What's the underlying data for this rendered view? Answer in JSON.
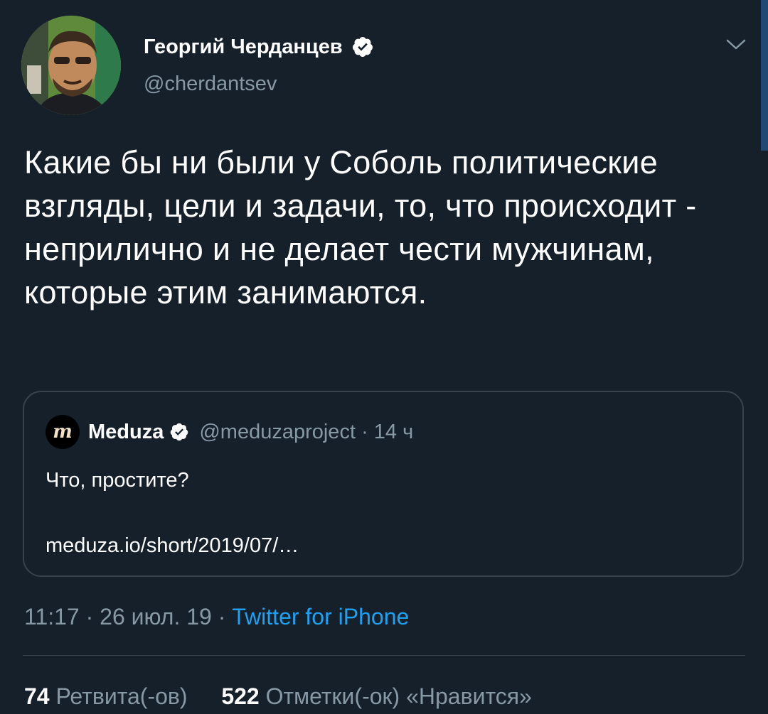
{
  "author": {
    "name": "Георгий Черданцев",
    "handle": "@cherdantsev",
    "verified": true,
    "avatar_icon": "profile-photo"
  },
  "tweet": {
    "text": "Какие бы ни были у Соболь политические взгляды, цели и задачи, то, что происходит - неприлично и не делает чести мужчинам, которые этим занимаются."
  },
  "quote": {
    "logo_letter": "m",
    "name": "Meduza",
    "handle": "@meduzaproject",
    "separator": "·",
    "time": "14 ч",
    "text": "Что, простите?",
    "link": "meduza.io/short/2019/07/…"
  },
  "meta": {
    "time": "11:17",
    "separator": "·",
    "date": "26 июл. 19",
    "source": "Twitter for iPhone"
  },
  "stats": {
    "retweets_count": "74",
    "retweets_label": "Ретвита(-ов)",
    "likes_count": "522",
    "likes_label": "Отметки(-ок) «Нравится»"
  },
  "colors": {
    "background": "#15202b",
    "text": "#ffffff",
    "secondary": "#8899a6",
    "link": "#1da1f2",
    "border": "#38444d"
  }
}
